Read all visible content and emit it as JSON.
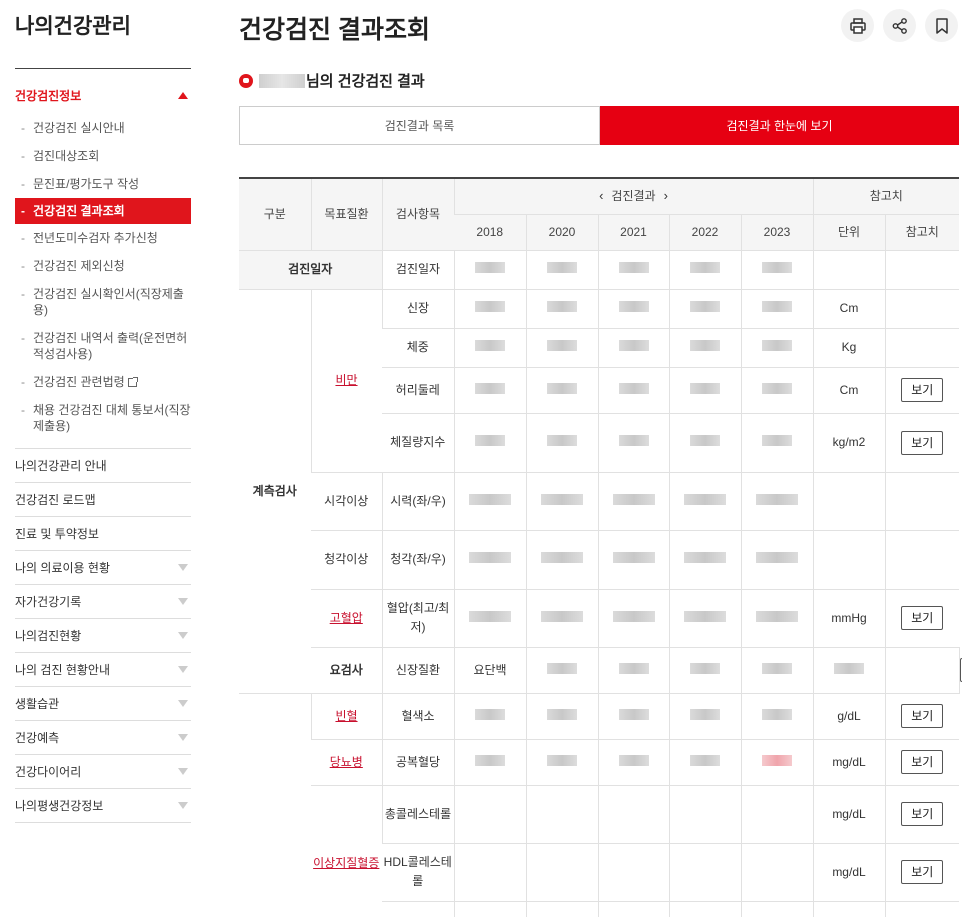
{
  "sidebar": {
    "title": "나의건강관리",
    "section": "건강검진정보",
    "sub_items": [
      {
        "label": "건강검진 실시안내"
      },
      {
        "label": "검진대상조회"
      },
      {
        "label": "문진표/평가도구 작성"
      },
      {
        "label": "건강검진 결과조회",
        "active": true
      },
      {
        "label": "전년도미수검자 추가신청"
      },
      {
        "label": "건강검진 제외신청"
      },
      {
        "label": "건강검진 실시확인서(직장제출용)"
      },
      {
        "label": "건강검진 내역서 출력(운전면허적성검사용)"
      },
      {
        "label": "건강검진 관련법령",
        "external": true
      },
      {
        "label": "채용 건강검진 대체 통보서(직장제출용)"
      }
    ],
    "menu": [
      {
        "label": "나의건강관리 안내",
        "expandable": false
      },
      {
        "label": "건강검진 로드맵",
        "expandable": false
      },
      {
        "label": "진료 및 투약정보",
        "expandable": false
      },
      {
        "label": "나의 의료이용 현황",
        "expandable": true
      },
      {
        "label": "자가건강기록",
        "expandable": true
      },
      {
        "label": "나의검진현황",
        "expandable": true
      },
      {
        "label": "나의 검진 현황안내",
        "expandable": true
      },
      {
        "label": "생활습관",
        "expandable": true
      },
      {
        "label": "건강예측",
        "expandable": true
      },
      {
        "label": "건강다이어리",
        "expandable": true
      },
      {
        "label": "나의평생건강정보",
        "expandable": true
      }
    ]
  },
  "page": {
    "title": "건강검진 결과조회",
    "subtitle_suffix": "님의 건강검진 결과",
    "actions": [
      "print-icon",
      "share-icon",
      "bookmark-icon"
    ]
  },
  "tabs": [
    {
      "label": "검진결과 목록",
      "active": false
    },
    {
      "label": "검진결과 한눈에 보기",
      "active": true
    }
  ],
  "table": {
    "headers": {
      "category": "구분",
      "target": "목표질환",
      "item": "검사항목",
      "results": "검진결과",
      "reference": "참고치",
      "unit": "단위",
      "ref": "참고치",
      "years": [
        "2018",
        "2020",
        "2021",
        "2022",
        "2023"
      ]
    },
    "view_label": "보기",
    "sections": {
      "date": "검진일자",
      "measure": "계측검사",
      "urine": "요검사"
    },
    "diseases": {
      "obesity": "비만",
      "vision": "시각이상",
      "hearing": "청각이상",
      "hypertension": "고혈압",
      "kidney": "신장질환",
      "anemia": "빈혈",
      "diabetes": "당뇨병",
      "dyslipidemia": "이상지질혈증"
    },
    "items": {
      "date": "검진일자",
      "height": "신장",
      "weight": "체중",
      "waist": "허리둘레",
      "bmi": "체질량지수",
      "vision": "시력(좌/우)",
      "hearing": "청각(좌/우)",
      "bp": "혈압(최고/최저)",
      "protein": "요단백",
      "hemoglobin": "혈색소",
      "glucose": "공복혈당",
      "cholesterol": "총콜레스테롤",
      "hdl": "HDL콜레스테롤"
    },
    "units": {
      "height": "Cm",
      "weight": "Kg",
      "waist": "Cm",
      "bmi": "kg/m2",
      "bp": "mmHg",
      "hemoglobin": "g/dL",
      "glucose": "mg/dL",
      "cholesterol": "mg/dL",
      "hdl": "mg/dL"
    }
  }
}
